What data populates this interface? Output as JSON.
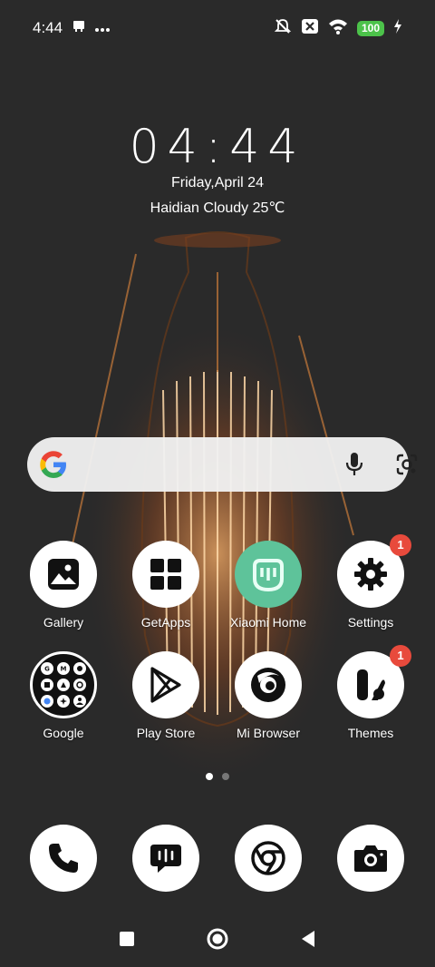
{
  "status_bar": {
    "time": "4:44",
    "battery": "100",
    "icons": [
      "notification-icon",
      "more-dots-icon",
      "mute-icon",
      "x-app-icon",
      "wifi-icon",
      "charging-icon"
    ]
  },
  "clock": {
    "time": "04:44",
    "date": "Friday,April 24",
    "weather": "Haidian Cloudy 25℃"
  },
  "search": {
    "icons": [
      "google-logo-icon",
      "microphone-icon",
      "lens-icon"
    ]
  },
  "apps": [
    {
      "label": "Gallery",
      "icon": "gallery-icon",
      "badge": ""
    },
    {
      "label": "GetApps",
      "icon": "getapps-icon",
      "badge": ""
    },
    {
      "label": "Xiaomi Home",
      "icon": "xiaomi-home-icon",
      "badge": ""
    },
    {
      "label": "Settings",
      "icon": "settings-icon",
      "badge": "1"
    },
    {
      "label": "Google",
      "icon": "google-folder-icon",
      "badge": ""
    },
    {
      "label": "Play Store",
      "icon": "play-store-icon",
      "badge": ""
    },
    {
      "label": "Mi Browser",
      "icon": "mi-browser-icon",
      "badge": ""
    },
    {
      "label": "Themes",
      "icon": "themes-icon",
      "badge": "1"
    }
  ],
  "page_indicator": {
    "current": 1,
    "total": 2
  },
  "dock": [
    "phone-icon",
    "messages-icon",
    "chrome-icon",
    "camera-icon"
  ],
  "navigation": [
    "recents-button",
    "home-button",
    "back-button"
  ],
  "colors": {
    "badge": "#e84a3c",
    "battery": "#4cc24a",
    "xiaomi_home": "#5ec39a"
  }
}
